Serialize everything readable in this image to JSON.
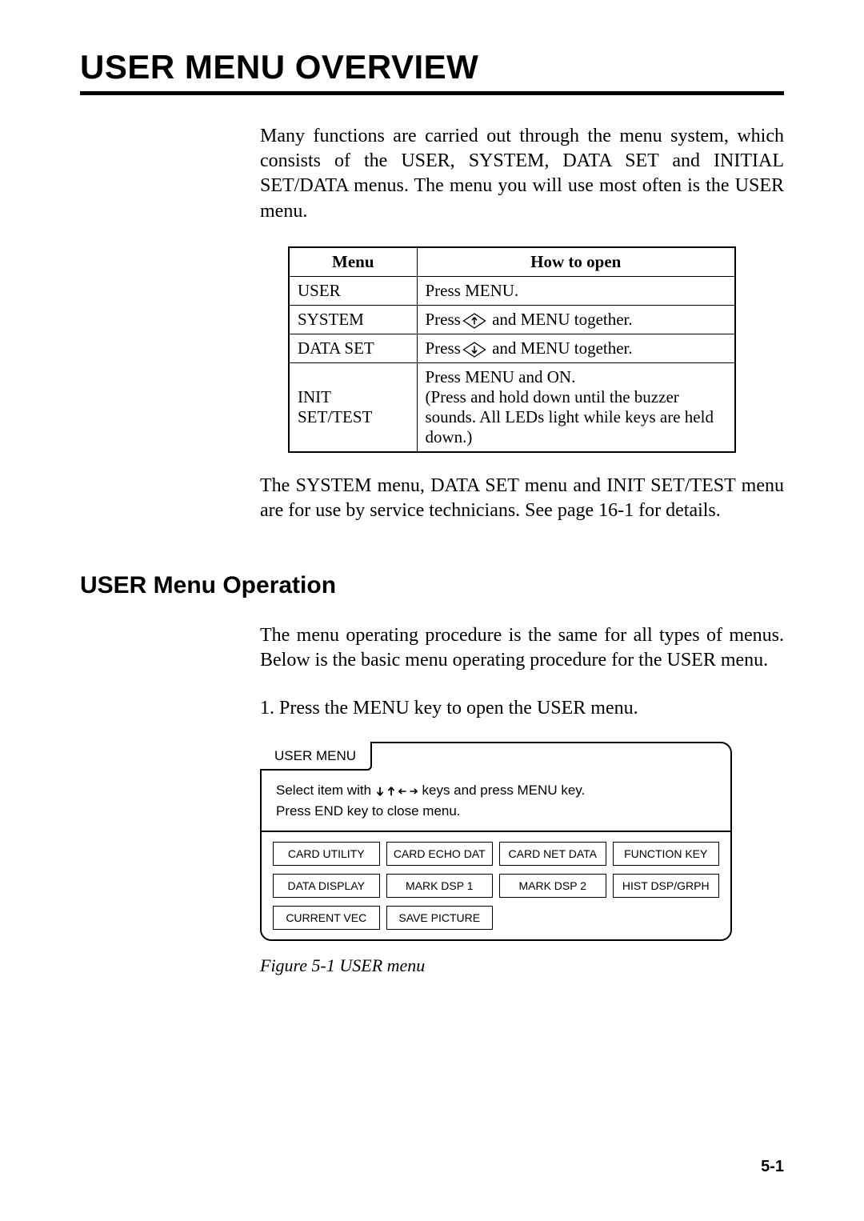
{
  "title": "USER MENU OVERVIEW",
  "intro": "Many functions are carried out through the menu system, which consists of the USER, SYSTEM, DATA SET and INITIAL SET/DATA menus. The menu you will use most often is the USER menu.",
  "table": {
    "header_menu": "Menu",
    "header_how": "How to open",
    "rows": [
      {
        "menu": "USER",
        "how_pre": "Press MENU.",
        "how_post": ""
      },
      {
        "menu": "SYSTEM",
        "how_pre": "Press",
        "how_post": " and MENU together."
      },
      {
        "menu": "DATA SET",
        "how_pre": "Press",
        "how_post": " and MENU together."
      },
      {
        "menu": "INIT SET/TEST",
        "how_pre": "Press MENU and ON.\n(Press and hold down until the buzzer sounds. All LEDs light while keys are held down.)",
        "how_post": ""
      }
    ]
  },
  "post_table": "The SYSTEM menu, DATA SET menu and INIT SET/TEST menu are for use by service technicians. See page 16-1 for details.",
  "subheading": "USER Menu Operation",
  "operation_intro": "The menu operating procedure is the same for all types of menus. Below is the basic menu operating procedure for the USER menu.",
  "step1": "1.  Press the MENU key to open the USER menu.",
  "menu_box": {
    "tab": "USER MENU",
    "instr_pre": "Select item with ",
    "instr_post": " keys and press MENU key.",
    "instr_line2": "Press END key to close menu.",
    "buttons": [
      "CARD UTILITY",
      "CARD ECHO DAT",
      "CARD NET DATA",
      "FUNCTION KEY",
      "DATA DISPLAY",
      "MARK DSP 1",
      "MARK DSP 2",
      "HIST DSP/GRPH",
      "CURRENT VEC",
      "SAVE PICTURE"
    ]
  },
  "figure_caption": "Figure 5-1 USER menu",
  "page_num": "5-1"
}
